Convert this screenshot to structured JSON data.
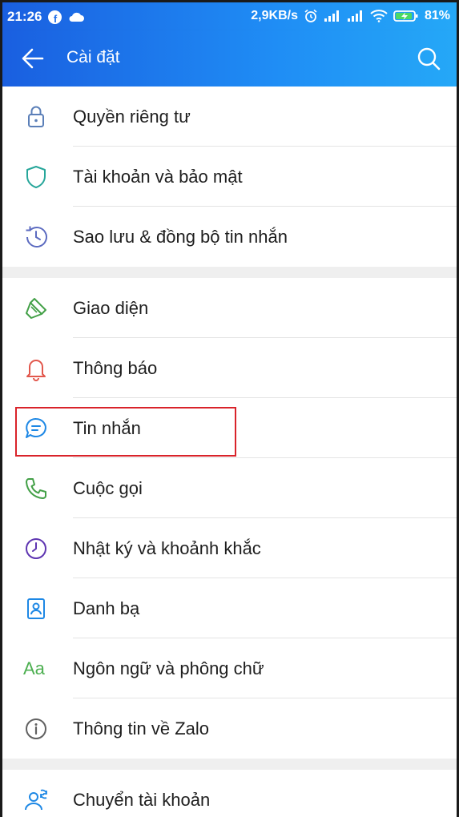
{
  "statusbar": {
    "time": "21:26",
    "network_speed": "2,9KB/s",
    "battery": "81%"
  },
  "appbar": {
    "title": "Cài đặt"
  },
  "settings": {
    "items": [
      {
        "label": "Quyền riêng tư",
        "icon": "lock-icon"
      },
      {
        "label": "Tài khoản và bảo mật",
        "icon": "shield-icon"
      },
      {
        "label": "Sao lưu & đồng bộ tin nhắn",
        "icon": "history-icon"
      },
      {
        "label": "Giao diện",
        "icon": "paint-brush-icon"
      },
      {
        "label": "Thông báo",
        "icon": "bell-icon"
      },
      {
        "label": "Tin nhắn",
        "icon": "chat-bubble-icon"
      },
      {
        "label": "Cuộc gọi",
        "icon": "phone-icon"
      },
      {
        "label": "Nhật ký và khoảnh khắc",
        "icon": "clock-icon"
      },
      {
        "label": "Danh bạ",
        "icon": "contact-card-icon"
      },
      {
        "label": "Ngôn ngữ và phông chữ",
        "icon": "font-icon",
        "icon_text": "Aa"
      },
      {
        "label": "Thông tin về Zalo",
        "icon": "info-icon"
      },
      {
        "label": "Chuyển tài khoản",
        "icon": "switch-account-icon"
      }
    ]
  },
  "colors": {
    "header_gradient_start": "#1a5fe0",
    "header_gradient_end": "#25a8f7",
    "highlight_border": "#d9232a"
  }
}
